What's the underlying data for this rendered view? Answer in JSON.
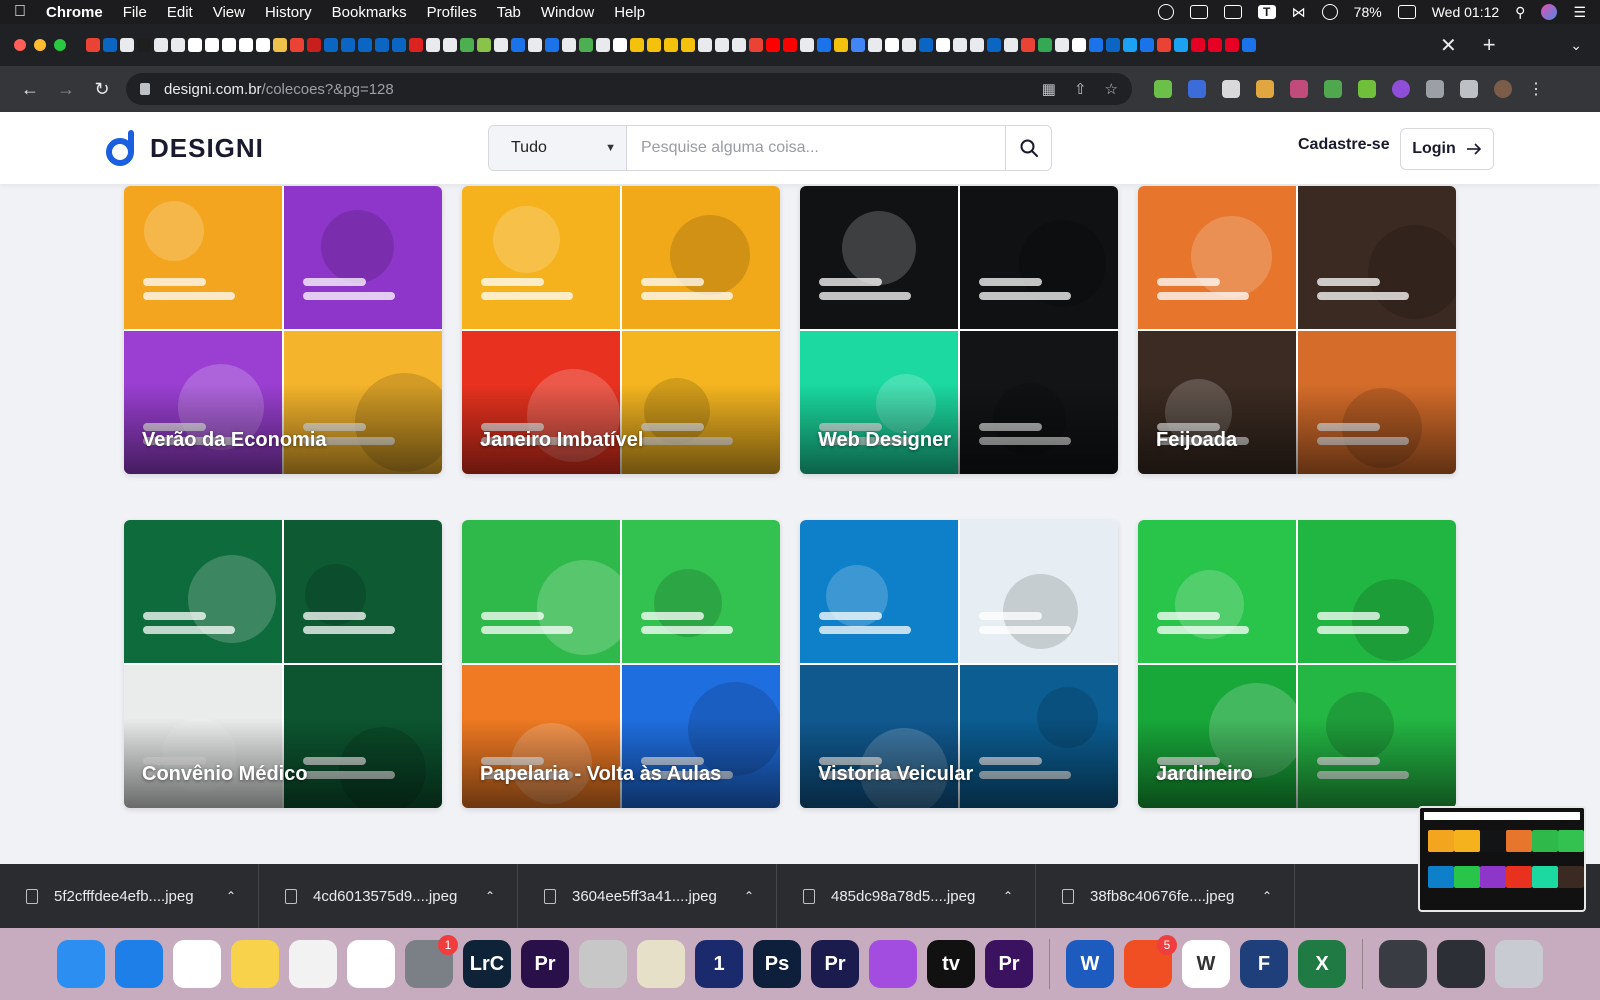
{
  "menubar": {
    "app_name": "Chrome",
    "items": [
      "File",
      "Edit",
      "View",
      "History",
      "Bookmarks",
      "Profiles",
      "Tab",
      "Window",
      "Help"
    ],
    "battery": "78%",
    "clock": "Wed 01:12"
  },
  "browser": {
    "url_host": "designi.com.br",
    "url_path": "/colecoes?&pg=128"
  },
  "site": {
    "brand": "DESIGNI",
    "search_category": "Tudo",
    "search_placeholder": "Pesquise alguma coisa...",
    "signup_label": "Cadastre-se",
    "login_label": "Login"
  },
  "collections": [
    {
      "title": "Verão da Economia",
      "tiles": [
        "#f3a51f",
        "#8e36c9",
        "#9a3fd2",
        "#f4b42c"
      ]
    },
    {
      "title": "Janeiro Imbatível",
      "tiles": [
        "#f5b21d",
        "#f2a919",
        "#e8321f",
        "#f4b520"
      ]
    },
    {
      "title": "Web Designer",
      "tiles": [
        "#101214",
        "#0f1113",
        "#1bd9a0",
        "#121416"
      ]
    },
    {
      "title": "Feijoada",
      "tiles": [
        "#e7762c",
        "#3a2a22",
        "#3b2b22",
        "#d56c2a"
      ]
    },
    {
      "title": "Convênio Médico",
      "tiles": [
        "#0e6b3c",
        "#0d5a33",
        "#e9eceb",
        "#0c5530"
      ]
    },
    {
      "title": "Papelaria - Volta às Aulas",
      "tiles": [
        "#2fb94a",
        "#33c14f",
        "#f07a23",
        "#1f6ee0"
      ]
    },
    {
      "title": "Vistoria Veicular",
      "tiles": [
        "#0e7fc9",
        "#e6eef3",
        "#10598f",
        "#0b5d92"
      ]
    },
    {
      "title": "Jardineiro",
      "tiles": [
        "#29c44a",
        "#21b641",
        "#18a83a",
        "#24b744"
      ]
    }
  ],
  "downloads": [
    {
      "name": "5f2cfffdee4efb....jpeg"
    },
    {
      "name": "4cd6013575d9....jpeg"
    },
    {
      "name": "3604ee5ff3a41....jpeg"
    },
    {
      "name": "485dc98a78d5....jpeg"
    },
    {
      "name": "38fb8c40676fe....jpeg"
    }
  ],
  "dock": [
    {
      "name": "finder-icon",
      "color": "#2b8ef0",
      "label": ""
    },
    {
      "name": "safari-icon",
      "color": "#1f7fe8",
      "label": ""
    },
    {
      "name": "chrome-icon",
      "color": "#ffffff",
      "label": ""
    },
    {
      "name": "notes-icon",
      "color": "#f7d24a",
      "label": ""
    },
    {
      "name": "textedit-icon",
      "color": "#f2f2f2",
      "label": ""
    },
    {
      "name": "photos-icon",
      "color": "#ffffff",
      "label": ""
    },
    {
      "name": "system-preferences-icon",
      "color": "#7b7f86",
      "label": "",
      "badge": "1"
    },
    {
      "name": "lightroom-classic-icon",
      "color": "#0f2338",
      "label": "LrC"
    },
    {
      "name": "premiere-icon",
      "color": "#2a1048",
      "label": "Pr"
    },
    {
      "name": "blocked-app-icon",
      "color": "#c7c7c7",
      "label": ""
    },
    {
      "name": "preview-icon",
      "color": "#e6e0c9",
      "label": ""
    },
    {
      "name": "1password-icon",
      "color": "#1a2a6c",
      "label": "1"
    },
    {
      "name": "photoshop-icon",
      "color": "#0d1f3a",
      "label": "Ps"
    },
    {
      "name": "premiere-alt-icon",
      "color": "#1c1b4d",
      "label": "Pr"
    },
    {
      "name": "podcasts-icon",
      "color": "#a34de0",
      "label": ""
    },
    {
      "name": "apple-tv-icon",
      "color": "#111111",
      "label": "tv"
    },
    {
      "name": "premiere-beta-icon",
      "color": "#3a1260",
      "label": "Pr"
    },
    {
      "name": "word-icon",
      "color": "#1d5bbf",
      "label": "W"
    },
    {
      "name": "office-icon",
      "color": "#f04e23",
      "label": "",
      "badge": "5"
    },
    {
      "name": "wunderlist-icon",
      "color": "#ffffff",
      "label": "W"
    },
    {
      "name": "feedly-icon",
      "color": "#1f3f7a",
      "label": "F"
    },
    {
      "name": "excel-icon",
      "color": "#1f7a43",
      "label": "X"
    },
    {
      "name": "downloads-stack-icon",
      "color": "#3a3c44",
      "label": ""
    },
    {
      "name": "screenshots-stack-icon",
      "color": "#2d2f36",
      "label": ""
    },
    {
      "name": "trash-icon",
      "color": "#c8ccd2",
      "label": ""
    }
  ]
}
